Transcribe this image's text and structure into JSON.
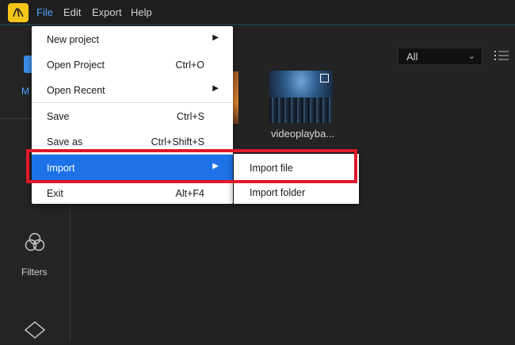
{
  "menubar": {
    "items": [
      "File",
      "Edit",
      "Export",
      "Help"
    ],
    "active": "File"
  },
  "sidebar": {
    "media_label": "M",
    "filters_label": "Filters"
  },
  "media": {
    "filter_value": "All",
    "clip_name": "videoplayba..."
  },
  "file_menu": {
    "items": [
      {
        "label": "New project",
        "shortcut": "",
        "submenu": true
      },
      {
        "label": "Open Project",
        "shortcut": "Ctrl+O",
        "submenu": false
      },
      {
        "label": "Open Recent",
        "shortcut": "",
        "submenu": true
      },
      {
        "label": "Save",
        "shortcut": "Ctrl+S",
        "submenu": false
      },
      {
        "label": "Save as",
        "shortcut": "Ctrl+Shift+S",
        "submenu": false
      },
      {
        "label": "Import",
        "shortcut": "",
        "submenu": true
      },
      {
        "label": "Exit",
        "shortcut": "Alt+F4",
        "submenu": false
      }
    ],
    "arrow_glyph": "▶"
  },
  "import_submenu": {
    "items": [
      "Import file",
      "Import folder"
    ]
  },
  "colors": {
    "accent": "#1d72e8",
    "highlight_border": "#e0182a",
    "logo": "#f5c518"
  }
}
